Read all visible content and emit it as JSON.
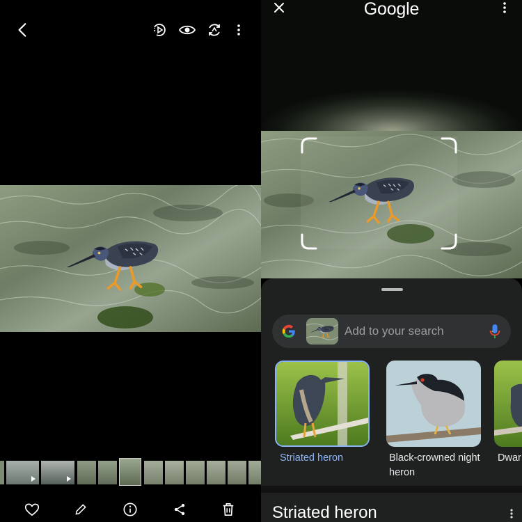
{
  "lens": {
    "brand": "Google",
    "search_placeholder": "Add to your search",
    "results": [
      {
        "label": "Striated heron",
        "selected": true
      },
      {
        "label": "Black-crowned night heron",
        "selected": false
      },
      {
        "label": "Dwar",
        "selected": false
      }
    ],
    "section_title": "Striated heron"
  },
  "colors": {
    "accent_blue": "#8ab4f8",
    "sheet_bg": "#1f2020",
    "searchbar_bg": "#303132",
    "google_blue": "#4285f4",
    "google_red": "#ea4335",
    "google_yellow": "#fbbc05",
    "google_green": "#34a853"
  },
  "icons": {
    "gallery_top": [
      "back-arrow-icon",
      "motion-photo-icon",
      "eye-icon",
      "remaster-icon",
      "more-vert-icon"
    ],
    "gallery_bottom": [
      "heart-icon",
      "pencil-icon",
      "info-icon",
      "share-icon",
      "trash-icon"
    ],
    "lens_top": [
      "close-icon",
      "more-vert-icon"
    ],
    "lens_search": [
      "google-g-icon",
      "mic-icon"
    ]
  }
}
